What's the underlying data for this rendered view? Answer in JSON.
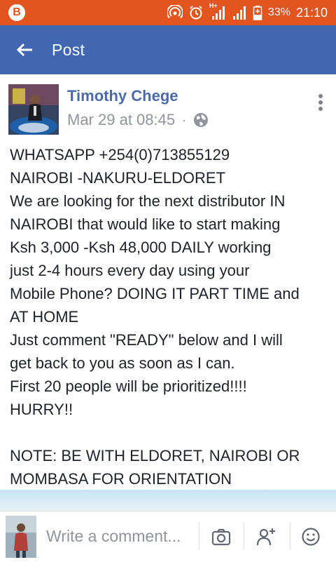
{
  "status_bar": {
    "battery": "33%",
    "time": "21:10",
    "network_label": "H+",
    "left_badge": "B",
    "icons": [
      "hotspot-icon",
      "alarm-icon",
      "signal-icon",
      "signal-icon",
      "battery-icon"
    ]
  },
  "app_bar": {
    "title": "Post",
    "back_icon": "arrow-left-icon"
  },
  "post": {
    "author": "Timothy Chege",
    "timestamp": "Mar 29 at 08:45",
    "separator": "·",
    "privacy_icon": "globe-icon",
    "menu_icon": "kebab-menu-icon",
    "lines": [
      "WHATSAPP +254(0)713855129",
      "NAIROBI -NAKURU-ELDORET",
      "We are looking for the next distributor IN",
      "NAIROBI that would like to start making",
      "Ksh 3,000 -Ksh 48,000 DAILY working",
      "just 2-4 hours every day using your",
      "Mobile Phone? DOING IT PART TIME and",
      "AT HOME",
      "Just comment \"READY\" below and I will",
      "get back to you as soon as I can.",
      "First 20 people will be prioritized!!!!",
      "HURRY!!",
      "",
      "NOTE: BE WITH ELDORET, NAIROBI OR",
      "MOMBASA FOR ORIENTATION"
    ]
  },
  "comment_bar": {
    "placeholder": "Write a comment...",
    "icons": [
      "camera-icon",
      "add-friend-icon",
      "emoji-icon"
    ]
  },
  "colors": {
    "status_bar": "#e2551f",
    "app_bar": "#4267b2",
    "author_link": "#4b6aa8",
    "meta_text": "#90949c"
  }
}
